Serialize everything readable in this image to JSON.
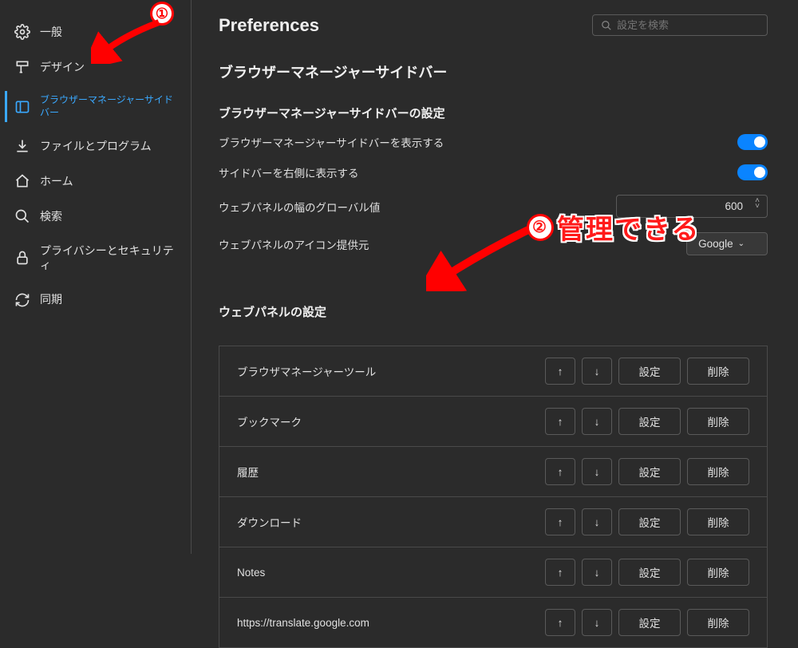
{
  "sidebar": {
    "items": [
      {
        "label": "一般"
      },
      {
        "label": "デザイン"
      },
      {
        "label": "ブラウザーマネージャーサイドバー"
      },
      {
        "label": "ファイルとプログラム"
      },
      {
        "label": "ホーム"
      },
      {
        "label": "検索"
      },
      {
        "label": "プライバシーとセキュリティ"
      },
      {
        "label": "同期"
      }
    ]
  },
  "header": {
    "title": "Preferences",
    "search_placeholder": "設定を検索"
  },
  "section": {
    "heading": "ブラウザーマネージャーサイドバー",
    "sub1": "ブラウザーマネージャーサイドバーの設定",
    "row_show": "ブラウザーマネージャーサイドバーを表示する",
    "row_right": "サイドバーを右側に表示する",
    "row_width": "ウェブパネルの幅のグローバル値",
    "width_value": "600",
    "row_provider": "ウェブパネルのアイコン提供元",
    "provider_value": "Google",
    "sub2": "ウェブパネルの設定"
  },
  "panels": [
    {
      "label": "ブラウザマネージャーツール",
      "settings": "設定",
      "delete": "削除"
    },
    {
      "label": "ブックマーク",
      "settings": "設定",
      "delete": "削除"
    },
    {
      "label": "履歴",
      "settings": "設定",
      "delete": "削除"
    },
    {
      "label": "ダウンロード",
      "settings": "設定",
      "delete": "削除"
    },
    {
      "label": "Notes",
      "settings": "設定",
      "delete": "削除"
    },
    {
      "label": "https://translate.google.com",
      "settings": "設定",
      "delete": "削除"
    }
  ],
  "annotations": {
    "circle1": "①",
    "circle2": "②",
    "text2": "管理できる"
  }
}
